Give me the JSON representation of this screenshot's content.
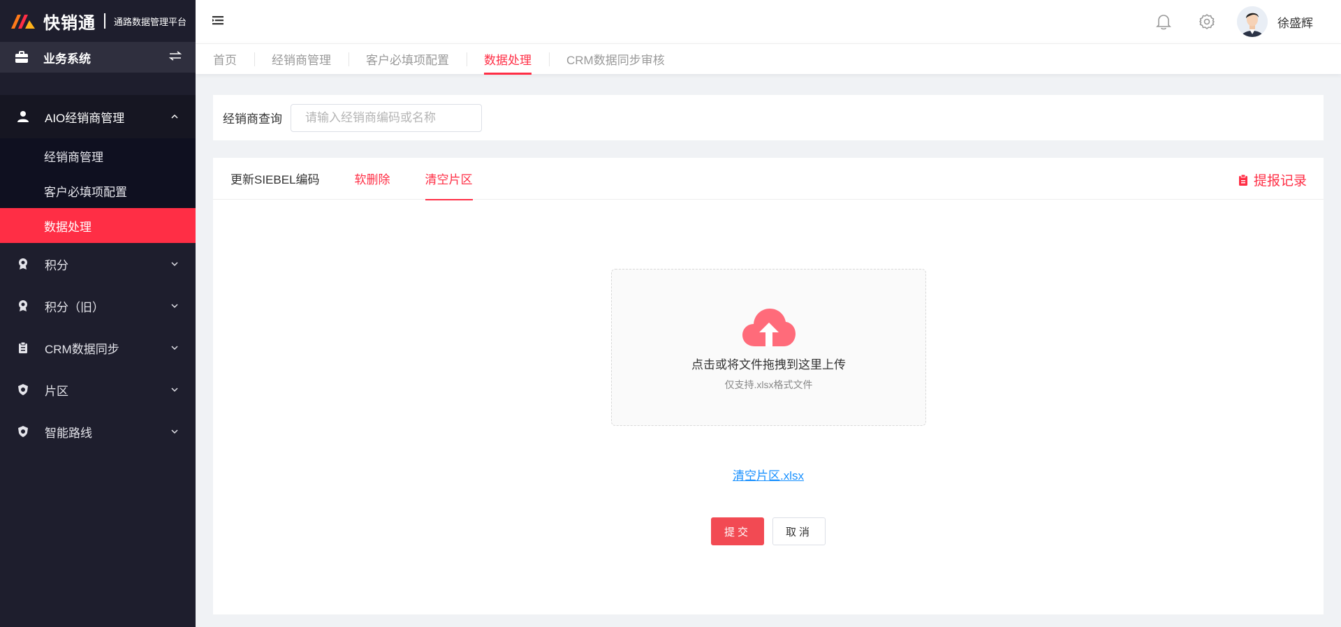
{
  "brand": {
    "name": "快销通",
    "subtitle": "通路数据管理平台",
    "colors": {
      "primary": "#ff2e45",
      "sidebar": "#1e1e2d"
    }
  },
  "sidebar": {
    "system_label": "业务系统",
    "group": {
      "label": "AIO经销商管理",
      "icon": "user-group-icon",
      "items": [
        {
          "label": "经销商管理"
        },
        {
          "label": "客户必填项配置"
        },
        {
          "label": "数据处理",
          "active": true
        }
      ]
    },
    "items": [
      {
        "label": "积分",
        "icon": "badge-icon"
      },
      {
        "label": "积分（旧）",
        "icon": "badge-icon"
      },
      {
        "label": "CRM数据同步",
        "icon": "clipboard-icon"
      },
      {
        "label": "片区",
        "icon": "shield-icon"
      },
      {
        "label": "智能路线",
        "icon": "shield-icon"
      }
    ]
  },
  "header": {
    "username": "徐盛辉"
  },
  "page_tabs": [
    {
      "label": "首页"
    },
    {
      "label": "经销商管理"
    },
    {
      "label": "客户必填项配置"
    },
    {
      "label": "数据处理",
      "active": true
    },
    {
      "label": "CRM数据同步审核"
    }
  ],
  "search": {
    "label": "经销商查询",
    "placeholder": "请输入经销商编码或名称",
    "value": ""
  },
  "card": {
    "tabs": [
      {
        "label": "更新SIEBEL编码",
        "color": "#333333"
      },
      {
        "label": "软删除",
        "color": "#ff2e45"
      },
      {
        "label": "清空片区",
        "color": "#ff2e45",
        "active": true
      }
    ],
    "records_label": "提报记录",
    "upload": {
      "text": "点击或将文件拖拽到这里上传",
      "hint": "仅支持.xlsx格式文件"
    },
    "file_name": "清空片区.xlsx",
    "submit_label": "提交",
    "cancel_label": "取消"
  }
}
